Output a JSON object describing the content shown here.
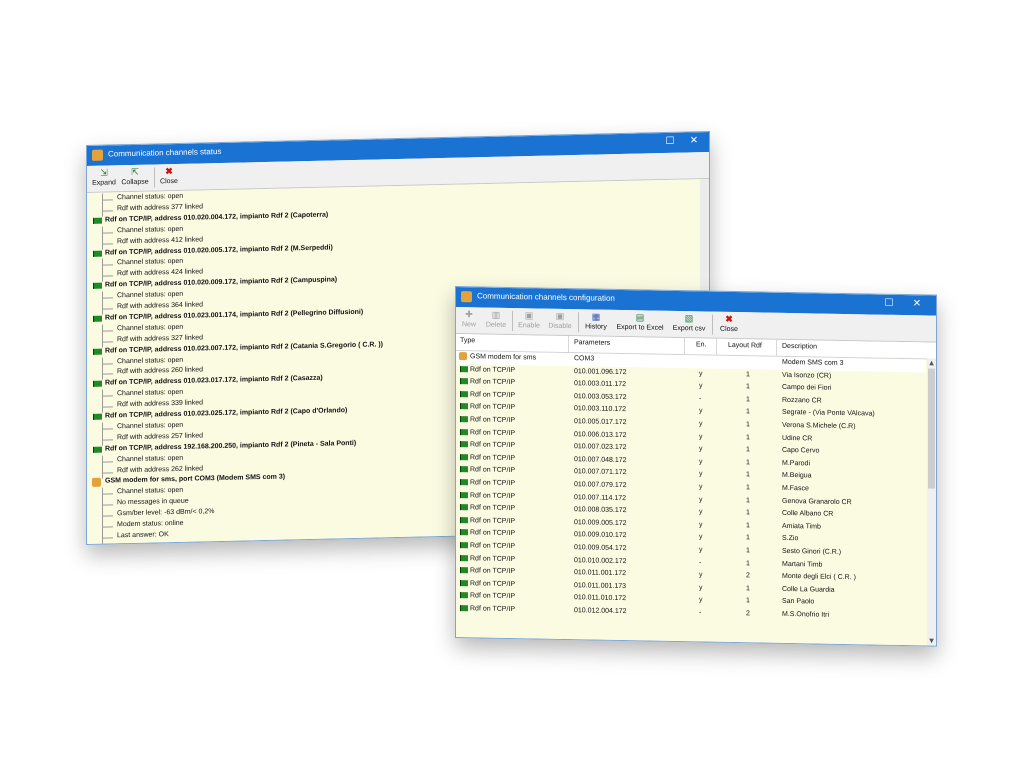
{
  "status_window": {
    "title": "Communication channels status",
    "controls": {
      "maximize": "☐",
      "close": "✕"
    },
    "toolbar": {
      "expand": "Expand",
      "collapse": "Collapse",
      "close": "Close"
    },
    "lines": [
      {
        "level": 1,
        "text": "Channel status: open"
      },
      {
        "level": 1,
        "text": "Rdf with address 377 linked"
      },
      {
        "level": 0,
        "icon": "flag",
        "text": "Rdf on TCP/IP, address 010.020.004.172, impianto Rdf 2 (Capoterra)"
      },
      {
        "level": 1,
        "text": "Channel status: open"
      },
      {
        "level": 1,
        "text": "Rdf with address 412 linked"
      },
      {
        "level": 0,
        "icon": "flag",
        "text": "Rdf on TCP/IP, address 010.020.005.172, impianto Rdf 2 (M.Serpeddi)"
      },
      {
        "level": 1,
        "text": "Channel status: open"
      },
      {
        "level": 1,
        "text": "Rdf with address 424 linked"
      },
      {
        "level": 0,
        "icon": "flag",
        "text": "Rdf on TCP/IP, address 010.020.009.172, impianto Rdf 2 (Campuspina)"
      },
      {
        "level": 1,
        "text": "Channel status: open"
      },
      {
        "level": 1,
        "text": "Rdf with address 364 linked"
      },
      {
        "level": 0,
        "icon": "flag",
        "text": "Rdf on TCP/IP, address 010.023.001.174, impianto Rdf 2 (Pellegrino Diffusioni)"
      },
      {
        "level": 1,
        "text": "Channel status: open"
      },
      {
        "level": 1,
        "text": "Rdf with address 327 linked"
      },
      {
        "level": 0,
        "icon": "flag",
        "text": "Rdf on TCP/IP, address 010.023.007.172, impianto Rdf 2 (Catania S.Gregorio ( C.R. ))"
      },
      {
        "level": 1,
        "text": "Channel status: open"
      },
      {
        "level": 1,
        "text": "Rdf with address 260 linked"
      },
      {
        "level": 0,
        "icon": "flag",
        "text": "Rdf on TCP/IP, address 010.023.017.172, impianto Rdf 2 (Casazza)"
      },
      {
        "level": 1,
        "text": "Channel status: open"
      },
      {
        "level": 1,
        "text": "Rdf with address 339 linked"
      },
      {
        "level": 0,
        "icon": "flag",
        "text": "Rdf on TCP/IP, address 010.023.025.172, impianto Rdf 2 (Capo d'Orlando)"
      },
      {
        "level": 1,
        "text": "Channel status: open"
      },
      {
        "level": 1,
        "text": "Rdf with address 257 linked"
      },
      {
        "level": 0,
        "icon": "flag",
        "text": "Rdf on TCP/IP, address 192.168.200.250, impianto Rdf 2 (Pineta - Sala Ponti)"
      },
      {
        "level": 1,
        "text": "Channel status: open"
      },
      {
        "level": 1,
        "text": "Rdf with address 262 linked"
      },
      {
        "level": 0,
        "icon": "gsm",
        "text": "GSM modem for sms, port COM3 (Modem SMS com 3)"
      },
      {
        "level": 1,
        "text": "Channel status: open"
      },
      {
        "level": 1,
        "text": "No messages in queue"
      },
      {
        "level": 1,
        "text": "Gsm/ber level: -63 dBm/< 0,2%"
      },
      {
        "level": 1,
        "text": "Modem status: online"
      },
      {
        "level": 1,
        "text": "Last answer: OK"
      }
    ]
  },
  "config_window": {
    "title": "Communication channels configuration",
    "controls": {
      "maximize": "☐",
      "close": "✕"
    },
    "toolbar": {
      "new": "New",
      "delete": "Delete",
      "enable": "Enable",
      "disable": "Disable",
      "history": "History",
      "export_excel": "Export to Excel",
      "export_csv": "Export csv",
      "close": "Close"
    },
    "columns": {
      "type": "Type",
      "parameters": "Parameters",
      "enabled": "En.",
      "layout": "Layout Rdf",
      "description": "Description"
    },
    "rows": [
      {
        "icon": "gsm",
        "type": "GSM modem for sms",
        "params": "COM3",
        "en": "",
        "layout": "",
        "desc": "Modem SMS com 3"
      },
      {
        "icon": "rdf",
        "type": "Rdf on TCP/IP",
        "params": "010.001.096.172",
        "en": "y",
        "layout": "1",
        "desc": "Via Isonzo (CR)"
      },
      {
        "icon": "rdf",
        "type": "Rdf on TCP/IP",
        "params": "010.003.011.172",
        "en": "y",
        "layout": "1",
        "desc": "Campo dei Fiori"
      },
      {
        "icon": "rdf",
        "type": "Rdf on TCP/IP",
        "params": "010.003.053.172",
        "en": "-",
        "layout": "1",
        "desc": "Rozzano CR"
      },
      {
        "icon": "rdf",
        "type": "Rdf on TCP/IP",
        "params": "010.003.110.172",
        "en": "y",
        "layout": "1",
        "desc": "Segrate - (Via Ponte VAlcava)"
      },
      {
        "icon": "rdf",
        "type": "Rdf on TCP/IP",
        "params": "010.005.017.172",
        "en": "y",
        "layout": "1",
        "desc": "Verona S.Michele (C.R)"
      },
      {
        "icon": "rdf",
        "type": "Rdf on TCP/IP",
        "params": "010.006.013.172",
        "en": "y",
        "layout": "1",
        "desc": "Udine CR"
      },
      {
        "icon": "rdf",
        "type": "Rdf on TCP/IP",
        "params": "010.007.023.172",
        "en": "y",
        "layout": "1",
        "desc": "Capo Cervo"
      },
      {
        "icon": "rdf",
        "type": "Rdf on TCP/IP",
        "params": "010.007.048.172",
        "en": "y",
        "layout": "1",
        "desc": "M.Parodi"
      },
      {
        "icon": "rdf",
        "type": "Rdf on TCP/IP",
        "params": "010.007.071.172",
        "en": "y",
        "layout": "1",
        "desc": "M.Beigua"
      },
      {
        "icon": "rdf",
        "type": "Rdf on TCP/IP",
        "params": "010.007.079.172",
        "en": "y",
        "layout": "1",
        "desc": "M.Fasce"
      },
      {
        "icon": "rdf",
        "type": "Rdf on TCP/IP",
        "params": "010.007.114.172",
        "en": "y",
        "layout": "1",
        "desc": "Genova Granarolo CR"
      },
      {
        "icon": "rdf",
        "type": "Rdf on TCP/IP",
        "params": "010.008.035.172",
        "en": "y",
        "layout": "1",
        "desc": "Colle Albano CR"
      },
      {
        "icon": "rdf",
        "type": "Rdf on TCP/IP",
        "params": "010.009.005.172",
        "en": "y",
        "layout": "1",
        "desc": "Amiata Timb"
      },
      {
        "icon": "rdf",
        "type": "Rdf on TCP/IP",
        "params": "010.009.010.172",
        "en": "y",
        "layout": "1",
        "desc": "S.Zio"
      },
      {
        "icon": "rdf",
        "type": "Rdf on TCP/IP",
        "params": "010.009.054.172",
        "en": "y",
        "layout": "1",
        "desc": "Sesto Ginori (C.R.)"
      },
      {
        "icon": "rdf",
        "type": "Rdf on TCP/IP",
        "params": "010.010.002.172",
        "en": "-",
        "layout": "1",
        "desc": "Martani Timb"
      },
      {
        "icon": "rdf",
        "type": "Rdf on TCP/IP",
        "params": "010.011.001.172",
        "en": "y",
        "layout": "2",
        "desc": "Monte degli Elci ( C.R. )"
      },
      {
        "icon": "rdf",
        "type": "Rdf on TCP/IP",
        "params": "010.011.001.173",
        "en": "y",
        "layout": "1",
        "desc": "Colle La Guardia"
      },
      {
        "icon": "rdf",
        "type": "Rdf on TCP/IP",
        "params": "010.011.010.172",
        "en": "y",
        "layout": "1",
        "desc": "San Paolo"
      },
      {
        "icon": "rdf",
        "type": "Rdf on TCP/IP",
        "params": "010.012.004.172",
        "en": "-",
        "layout": "2",
        "desc": "M.S.Onofrio Itri"
      }
    ]
  }
}
